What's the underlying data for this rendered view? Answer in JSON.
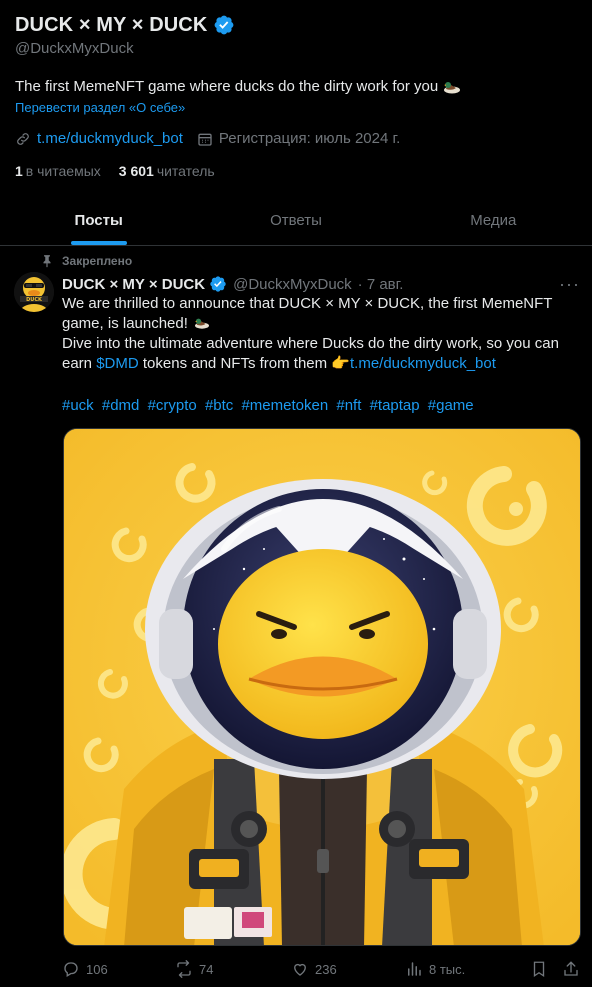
{
  "profile": {
    "display_name": "DUCK × MY × DUCK",
    "handle": "@DuckxMyxDuck",
    "bio": "The first MemeNFT game where ducks do the dirty work for you",
    "translate_label": "Перевести раздел «О себе»",
    "link": "t.me/duckmyduck_bot",
    "joined": "Регистрация: июль 2024 г.",
    "following_count": "1",
    "following_label": "в читаемых",
    "followers_count": "3 601",
    "followers_label": "читатель"
  },
  "tabs": [
    {
      "label": "Посты",
      "active": true
    },
    {
      "label": "Ответы",
      "active": false
    },
    {
      "label": "Медиа",
      "active": false
    }
  ],
  "post": {
    "pinned_label": "Закреплено",
    "author_name": "DUCK × MY × DUCK",
    "author_handle": "@DuckxMyxDuck",
    "time": "· 7 авг.",
    "line1": "We are thrilled to announce that DUCK × MY × DUCK, the first MemeNFT",
    "line2": "game, is launched!",
    "line3": "Dive into the ultimate adventure where Ducks do the dirty work, so you can",
    "line4_prefix": "earn",
    "cashtag": "$DMD",
    "line4_middle": "tokens and NFTs from them",
    "line4_link": "t.me/duckmyduck_bot",
    "hashtags": [
      "#uck",
      "#dmd",
      "#crypto",
      "#btc",
      "#memetoken",
      "#nft",
      "#taptap",
      "#game"
    ],
    "replies": "106",
    "reposts": "74",
    "likes": "236",
    "views": "8 тыс."
  },
  "colors": {
    "accent": "#1d9bf0",
    "background": "#000000",
    "muted": "#71767b",
    "media_yellow": "#f8c739"
  },
  "icons": [
    "verified-badge-icon",
    "duck-emoji-icon",
    "link-icon",
    "calendar-icon",
    "pin-icon",
    "more-icon",
    "reply-icon",
    "repost-icon",
    "like-icon",
    "views-icon",
    "bookmark-icon",
    "share-icon"
  ]
}
